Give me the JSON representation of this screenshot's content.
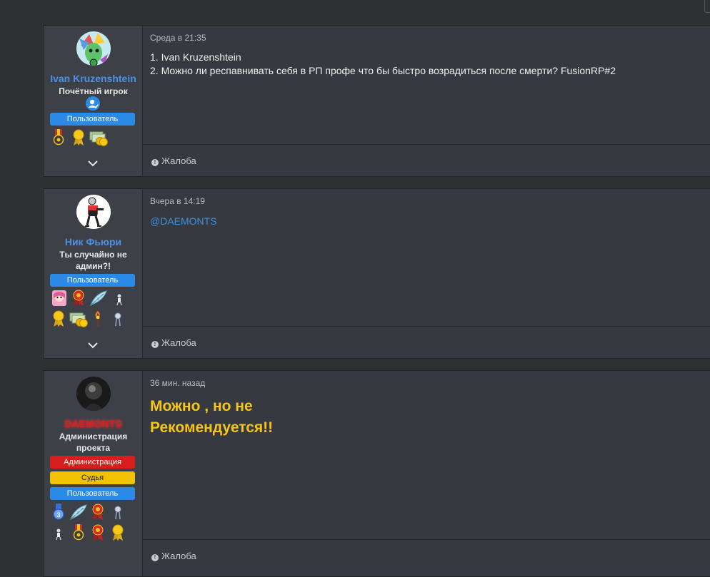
{
  "posts": [
    {
      "user": {
        "name": "Ivan Kruzenshtein",
        "title": "Почётный игрок",
        "banners": [
          "Пользователь"
        ]
      },
      "date": "Среда в 21:35",
      "lines": [
        "1. Ivan Kruzenshtein",
        "2. Можно ли респавнивать себя в РП профе что бы быстро возрадиться после смерти? FusionRP#2"
      ],
      "report": "Жалоба"
    },
    {
      "user": {
        "name": "Ник Фьюри",
        "title": "Ты случайно не админ?!",
        "banners": [
          "Пользователь"
        ]
      },
      "date": "Вчера в 14:19",
      "mention": "@DAEMONTS",
      "report": "Жалоба"
    },
    {
      "user": {
        "name": "DAEMONTS",
        "title": "Администрация проекта",
        "banners": [
          "Администрация",
          "Судья",
          "Пользователь"
        ]
      },
      "date": "36 мин. назад",
      "lines": [
        "Можно , но не",
        "Рекомендуется!!"
      ],
      "report": "Жалоба"
    }
  ],
  "colors": {
    "name_blue": "#4d90e8",
    "name_red": "#d81d1d",
    "banner_user": "#2b8ae6",
    "banner_admin": "#d81d1d",
    "banner_judge": "#f2c200",
    "accent_yellow": "#f5c518"
  }
}
